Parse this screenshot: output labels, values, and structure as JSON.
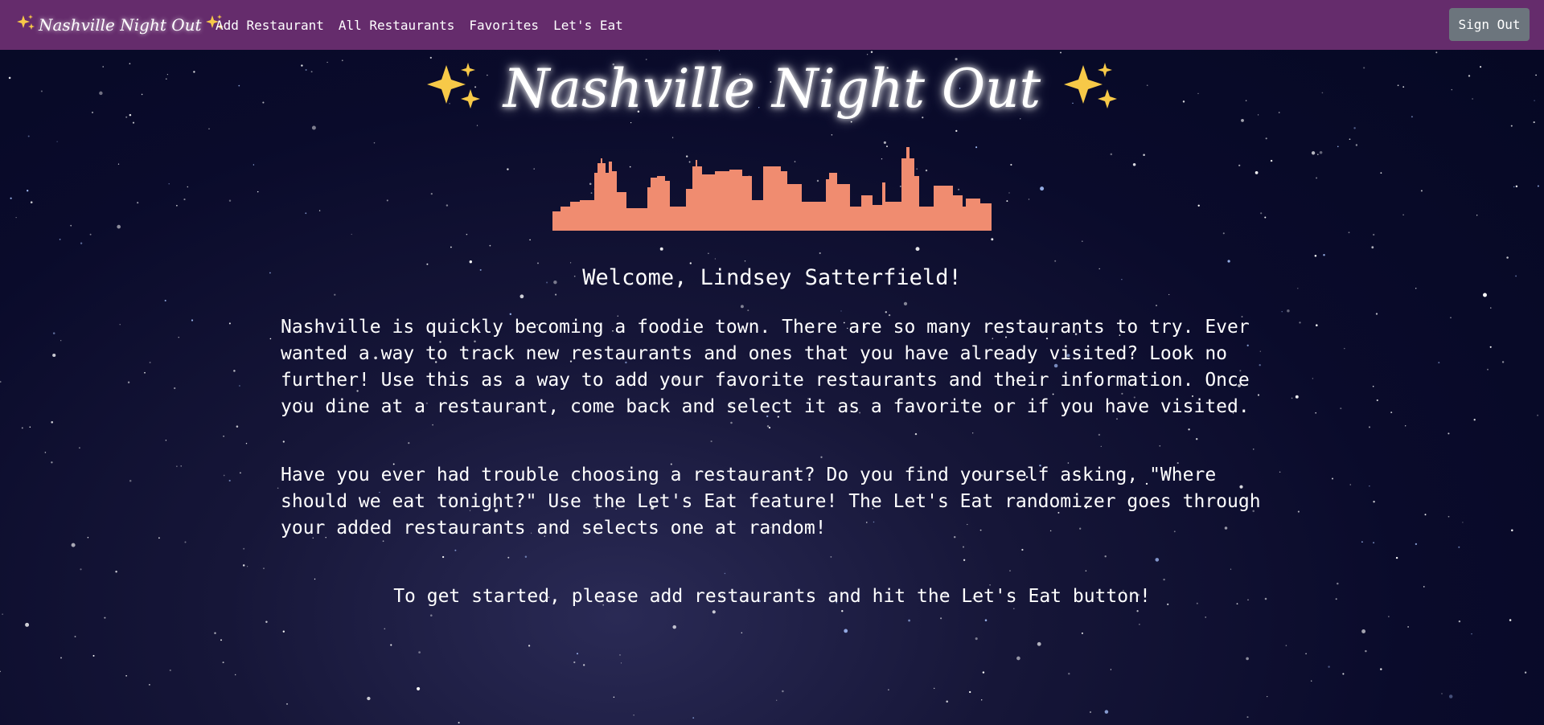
{
  "brand": {
    "name": "Nashville Night Out"
  },
  "nav": {
    "items": [
      "Add Restaurant",
      "All Restaurants",
      "Favorites",
      "Let's Eat"
    ],
    "signout_label": "Sign Out"
  },
  "hero": {
    "title": "Nashville Night Out"
  },
  "content": {
    "welcome": "Welcome, Lindsey Satterfield!",
    "para1": "Nashville is quickly becoming a foodie town. There are so many restaurants to try. Ever wanted a way to track new restaurants and ones that you have already visited? Look no further! Use this as a way to add your favorite restaurants and their information. Once you dine at a restaurant, come back and select it as a favorite or if you have visited.",
    "para2": "Have you ever had trouble choosing a restaurant? Do you find yourself asking, \"Where should we eat tonight?\" Use the Let's Eat feature! The Let's Eat randomizer goes through your added restaurants and selects one at random!",
    "cta": "To get started, please add restaurants and hit the Let's Eat button!"
  },
  "colors": {
    "navbar": "#652c6c",
    "signout": "#6c757d",
    "skyline": "#f08c70",
    "sparkle": "#f7c948",
    "background": "#050823"
  },
  "icons": {
    "sparkle": "sparkles-icon",
    "skyline": "city-skyline-icon"
  }
}
